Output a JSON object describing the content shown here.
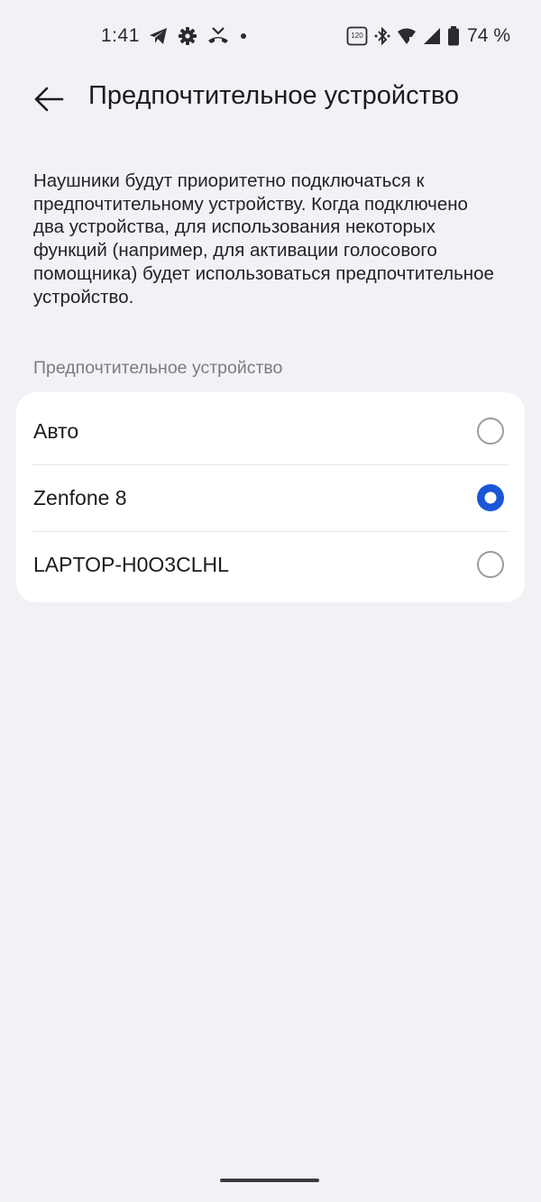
{
  "status_bar": {
    "time": "1:41",
    "battery_percent": "74 %",
    "left_icons": [
      "telegram-icon",
      "settings-gear-icon",
      "call-forward-icon",
      "dot-icon"
    ],
    "right_icons": [
      "refresh-rate-120-icon",
      "bluetooth-icon",
      "wifi-icon",
      "signal-icon",
      "battery-icon"
    ]
  },
  "app_bar": {
    "title": "Предпочтительное устройство"
  },
  "description": "Наушники будут приоритетно подключаться к предпочтительному устройству. Когда подключено два устройства, для использования некоторых функций (например, для активации голосового помощника) будет использоваться предпочтительное устройство.",
  "section": {
    "header": "Предпочтительное устройство",
    "options": [
      {
        "label": "Авто",
        "selected": false
      },
      {
        "label": "Zenfone 8",
        "selected": true
      },
      {
        "label": "LAPTOP-H0O3CLHL",
        "selected": false
      }
    ]
  },
  "colors": {
    "background": "#f1f2f5",
    "card": "#ffffff",
    "accent": "#1a56d6",
    "radio_unselected": "#9a9ca1"
  }
}
